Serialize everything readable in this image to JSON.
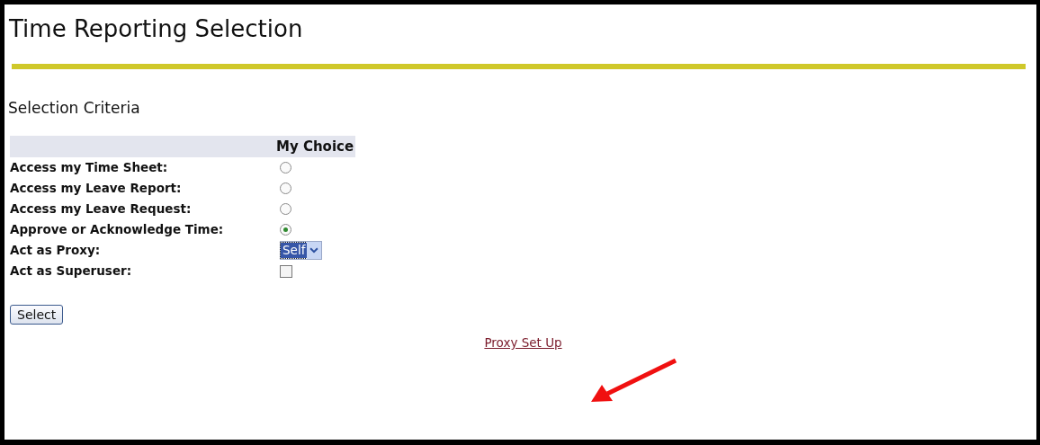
{
  "title": "Time Reporting Selection",
  "section_title": "Selection Criteria",
  "table": {
    "column_header": "My Choice",
    "rows": [
      {
        "label": "Access my Time Sheet:",
        "kind": "radio",
        "selected": false
      },
      {
        "label": "Access my Leave Report:",
        "kind": "radio",
        "selected": false
      },
      {
        "label": "Access my Leave Request:",
        "kind": "radio",
        "selected": false
      },
      {
        "label": "Approve or Acknowledge Time:",
        "kind": "radio",
        "selected": true
      },
      {
        "label": "Act as Proxy:",
        "kind": "select",
        "value": "Self"
      },
      {
        "label": "Act as Superuser:",
        "kind": "checkbox",
        "checked": false
      }
    ]
  },
  "button": "Select",
  "link": "Proxy Set Up"
}
